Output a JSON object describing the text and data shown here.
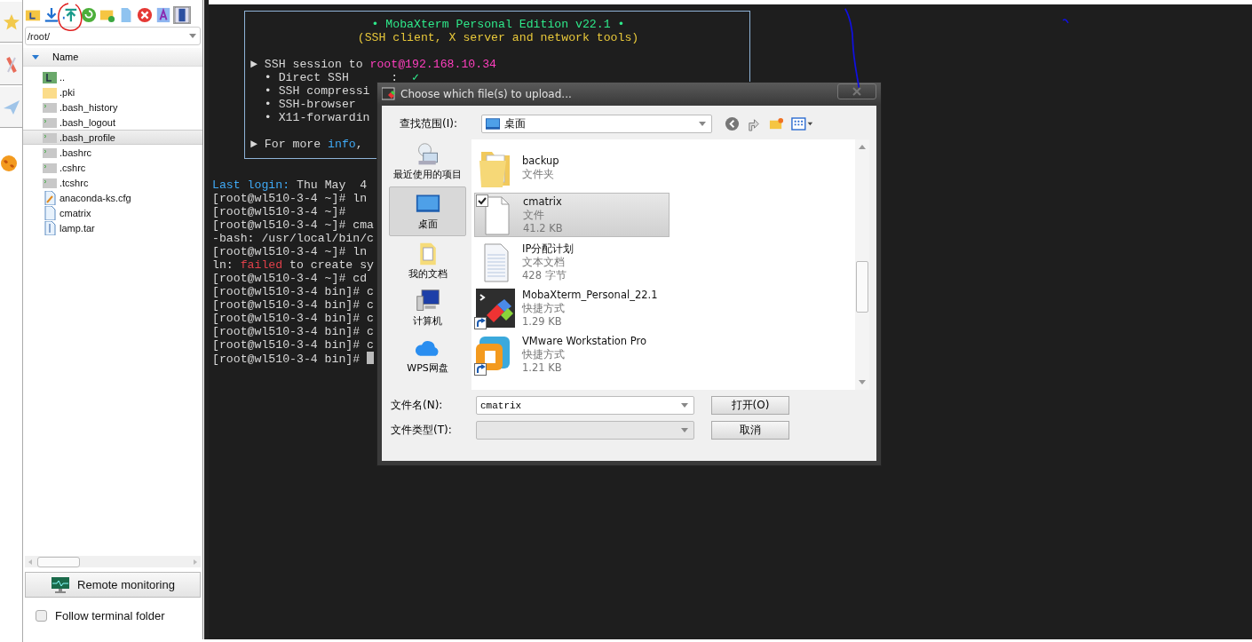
{
  "file_panel": {
    "path": "/root/",
    "column": "Name",
    "files": [
      {
        "name": "..",
        "kind": "parent",
        "selected": false
      },
      {
        "name": ".pki",
        "kind": "folder",
        "selected": false
      },
      {
        "name": ".bash_history",
        "kind": "shell",
        "selected": false
      },
      {
        "name": ".bash_logout",
        "kind": "shell",
        "selected": false
      },
      {
        "name": ".bash_profile",
        "kind": "shell",
        "selected": true
      },
      {
        "name": ".bashrc",
        "kind": "shell",
        "selected": false
      },
      {
        "name": ".cshrc",
        "kind": "shell",
        "selected": false
      },
      {
        "name": ".tcshrc",
        "kind": "shell",
        "selected": false
      },
      {
        "name": "anaconda-ks.cfg",
        "kind": "script",
        "selected": false
      },
      {
        "name": "cmatrix",
        "kind": "file",
        "selected": false
      },
      {
        "name": "lamp.tar",
        "kind": "archive",
        "selected": false
      }
    ],
    "remote_button": "Remote monitoring",
    "follow": {
      "label": "Follow terminal folder",
      "checked": false
    }
  },
  "terminal": {
    "banner": {
      "title": "• MobaXterm Personal Edition v22.1 •",
      "subtitle": "(SSH client, X server and network tools)",
      "session": [
        [
          {
            "text": "► SSH session to ",
            "kind": "plain"
          },
          {
            "text": "root@192.168.10.34",
            "kind": "host"
          }
        ],
        [
          {
            "text": "  • Direct SSH      :  ",
            "kind": "plain"
          },
          {
            "text": "✓",
            "kind": "ok"
          }
        ],
        [
          {
            "text": "  • SSH compressi",
            "kind": "plain"
          }
        ],
        [
          {
            "text": "  • SSH-browser",
            "kind": "plain"
          }
        ],
        [
          {
            "text": "  • X11-forwardin",
            "kind": "plain"
          }
        ]
      ],
      "footer": [
        {
          "text": "► For more ",
          "kind": "plain"
        },
        {
          "text": "info",
          "kind": "keyword"
        },
        {
          "text": ",",
          "kind": "plain"
        }
      ]
    },
    "lines": [
      [
        {
          "text": "Last login:",
          "kind": "keyword"
        },
        {
          "text": " Thu May  4",
          "kind": "plain"
        }
      ],
      [
        {
          "text": "[root@wl510-3-4 ~]# ln",
          "kind": "plain"
        }
      ],
      [
        {
          "text": "[root@wl510-3-4 ~]#",
          "kind": "plain"
        }
      ],
      [
        {
          "text": "[root@wl510-3-4 ~]# cma",
          "kind": "plain"
        }
      ],
      [
        {
          "text": "-bash: /usr/local/bin/c",
          "kind": "plain"
        }
      ],
      [
        {
          "text": "[root@wl510-3-4 ~]# ln",
          "kind": "plain"
        }
      ],
      [
        {
          "text": "ln: ",
          "kind": "plain"
        },
        {
          "text": "failed",
          "kind": "error"
        },
        {
          "text": " to create sy",
          "kind": "plain"
        }
      ],
      [
        {
          "text": "[root@wl510-3-4 ~]# cd",
          "kind": "plain"
        }
      ],
      [
        {
          "text": "[root@wl510-3-4 bin]# c",
          "kind": "plain"
        }
      ],
      [
        {
          "text": "[root@wl510-3-4 bin]# c",
          "kind": "plain"
        }
      ],
      [
        {
          "text": "[root@wl510-3-4 bin]# c",
          "kind": "plain"
        }
      ],
      [
        {
          "text": "[root@wl510-3-4 bin]# c",
          "kind": "plain"
        }
      ],
      [
        {
          "text": "[root@wl510-3-4 bin]# c",
          "kind": "plain"
        }
      ],
      [
        {
          "text": "[root@wl510-3-4 bin]# ",
          "kind": "plain"
        }
      ]
    ]
  },
  "dialog": {
    "title": "Choose which file(s) to upload...",
    "look_in_label": "查找范围(I):",
    "look_in": "桌面",
    "places": [
      {
        "label": "最近使用的项目",
        "kind": "recent",
        "selected": false
      },
      {
        "label": "桌面",
        "kind": "desktop",
        "selected": true
      },
      {
        "label": "我的文档",
        "kind": "documents",
        "selected": false
      },
      {
        "label": "计算机",
        "kind": "computer",
        "selected": false
      },
      {
        "label": "WPS网盘",
        "kind": "cloud",
        "selected": false
      }
    ],
    "files": [
      {
        "name": "backup",
        "type": "文件夹",
        "kind": "folder",
        "shortcut": false,
        "selected": false,
        "checked": false
      },
      {
        "name": "cmatrix",
        "type": "文件",
        "size": "41.2 KB",
        "kind": "file",
        "shortcut": false,
        "selected": true,
        "checked": true
      },
      {
        "name": "IP分配计划",
        "type": "文本文档",
        "size": "428 字节",
        "kind": "text",
        "shortcut": false,
        "selected": false,
        "checked": false
      },
      {
        "name": "MobaXterm_Personal_22.1",
        "type": "快捷方式",
        "size": "1.29 KB",
        "kind": "terminal",
        "shortcut": true,
        "selected": false,
        "checked": false
      },
      {
        "name": "VMware Workstation Pro",
        "type": "快捷方式",
        "size": "1.21 KB",
        "kind": "vm",
        "shortcut": true,
        "selected": false,
        "checked": false
      }
    ],
    "filename_label": "文件名(N):",
    "filename": "cmatrix",
    "filetype_label": "文件类型(T):",
    "buttons": [
      "打开(O)",
      "取消"
    ]
  }
}
